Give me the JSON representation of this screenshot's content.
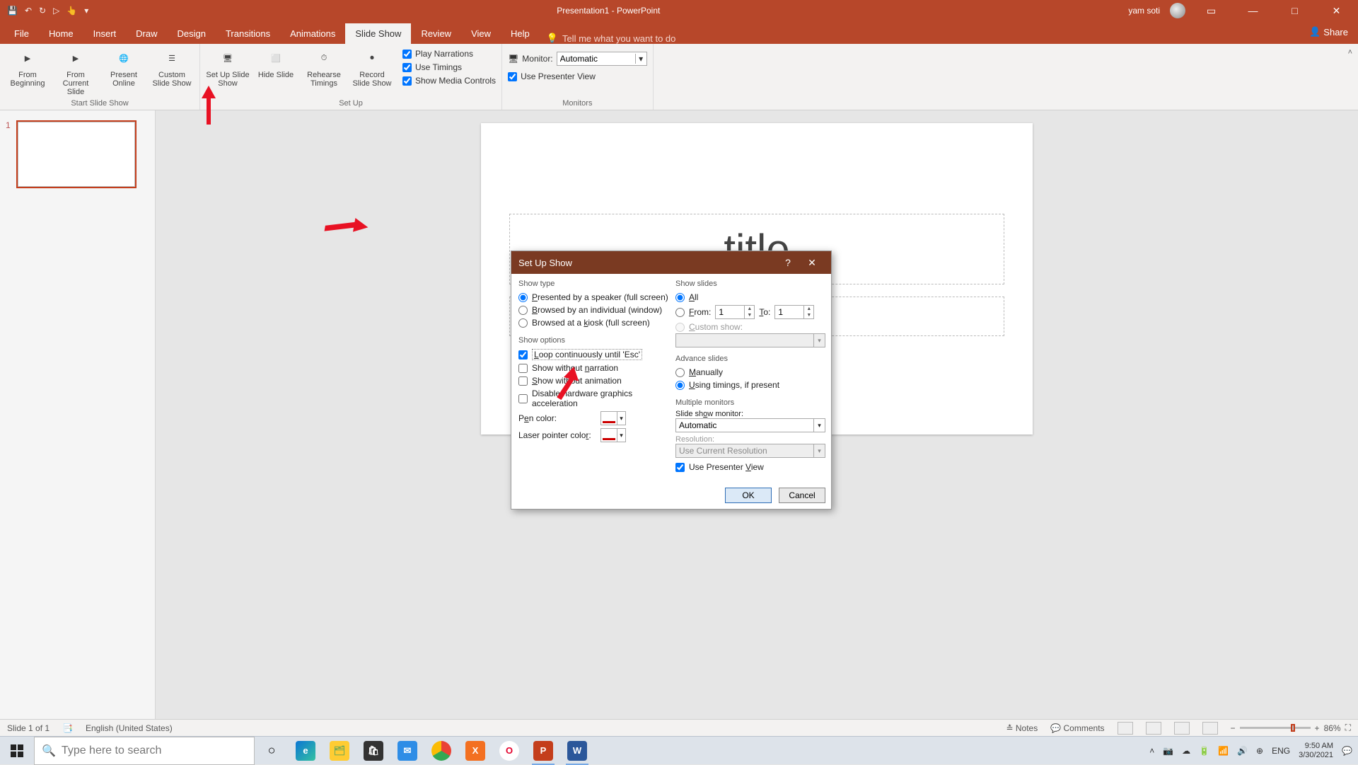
{
  "titlebar": {
    "title": "Presentation1 - PowerPoint",
    "user": "yam soti"
  },
  "tabs": {
    "items": [
      "File",
      "Home",
      "Insert",
      "Draw",
      "Design",
      "Transitions",
      "Animations",
      "Slide Show",
      "Review",
      "View",
      "Help"
    ],
    "active": "Slide Show",
    "tell": "Tell me what you want to do",
    "share": "Share"
  },
  "ribbon": {
    "start": {
      "from_beginning": "From Beginning",
      "from_current": "From Current Slide",
      "present_online": "Present Online",
      "custom_show": "Custom Slide Show",
      "label": "Start Slide Show"
    },
    "setup": {
      "setup_show": "Set Up Slide Show",
      "hide_slide": "Hide Slide",
      "rehearse": "Rehearse Timings",
      "record": "Record Slide Show",
      "play_narrations": "Play Narrations",
      "use_timings": "Use Timings",
      "show_media": "Show Media Controls",
      "label": "Set Up"
    },
    "monitors": {
      "monitor_label": "Monitor:",
      "monitor_value": "Automatic",
      "presenter_view": "Use Presenter View",
      "label": "Monitors"
    }
  },
  "thumb": {
    "num": "1"
  },
  "slide": {
    "title_visible": "title"
  },
  "dialog": {
    "title": "Set Up Show",
    "show_type": {
      "legend": "Show type",
      "presented": "Presented by a speaker (full screen)",
      "browsed_ind": "Browsed by an individual (window)",
      "browsed_kiosk": "Browsed at a kiosk (full screen)"
    },
    "show_options": {
      "legend": "Show options",
      "loop": "Loop continuously until 'Esc'",
      "no_narration": "Show without narration",
      "no_animation": "Show without animation",
      "disable_hw": "Disable hardware graphics acceleration",
      "pen_color": "Pen color:",
      "laser_color": "Laser pointer color:"
    },
    "show_slides": {
      "legend": "Show slides",
      "all": "All",
      "from": "From:",
      "to": "To:",
      "from_val": "1",
      "to_val": "1",
      "custom": "Custom show:"
    },
    "advance": {
      "legend": "Advance slides",
      "manually": "Manually",
      "timings": "Using timings, if present"
    },
    "multimon": {
      "legend": "Multiple monitors",
      "monitor_label": "Slide show monitor:",
      "monitor_value": "Automatic",
      "resolution_label": "Resolution:",
      "resolution_value": "Use Current Resolution",
      "presenter_view": "Use Presenter View"
    },
    "ok": "OK",
    "cancel": "Cancel"
  },
  "status": {
    "slide": "Slide 1 of 1",
    "lang": "English (United States)",
    "notes": "Notes",
    "comments": "Comments",
    "zoom": "86%"
  },
  "taskbar": {
    "search_placeholder": "Type here to search",
    "lang": "ENG",
    "time": "9:50 AM",
    "date": "3/30/2021"
  }
}
